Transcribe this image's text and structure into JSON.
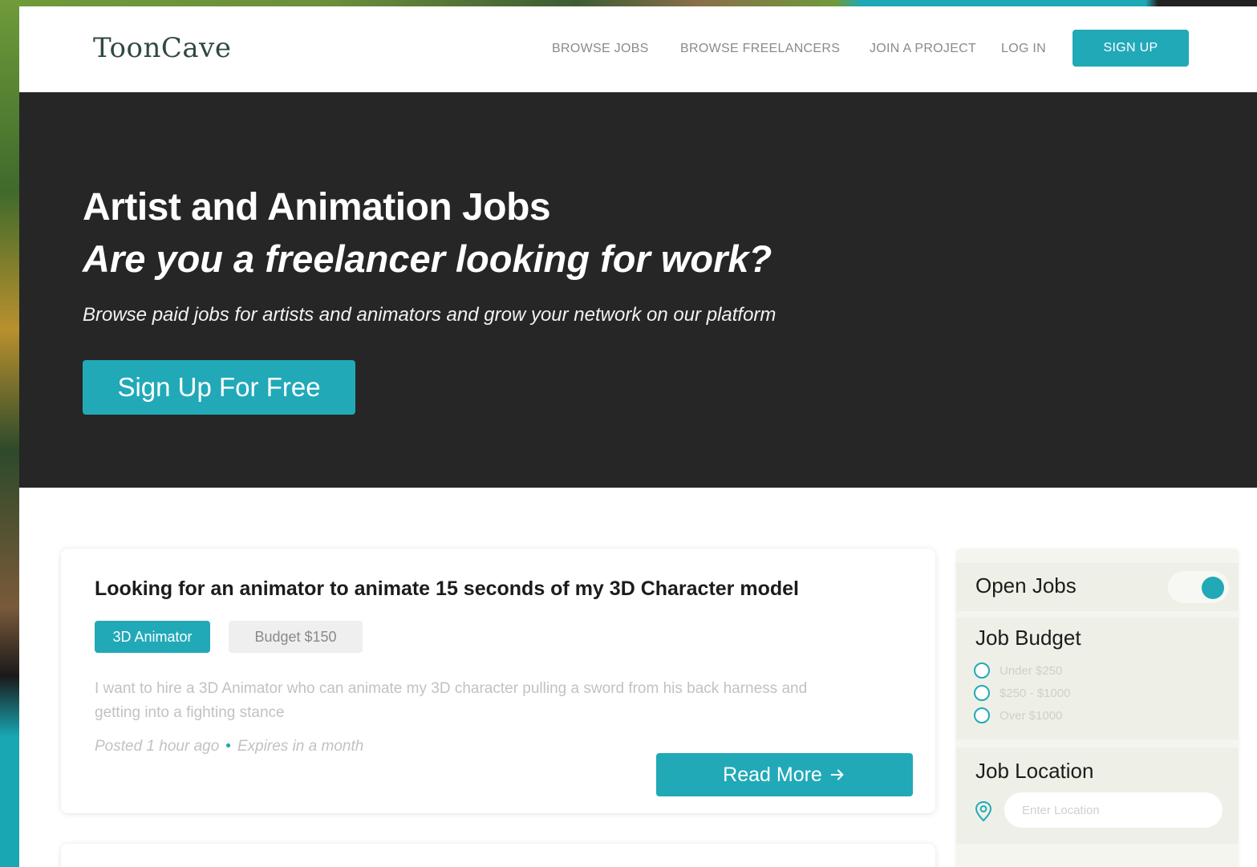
{
  "brand": {
    "name": "ToonCave"
  },
  "nav": {
    "links": [
      "BROWSE JOBS",
      "BROWSE FREELANCERS",
      "JOIN A PROJECT",
      "LOG IN"
    ],
    "signup_label": "SIGN UP"
  },
  "hero": {
    "title": "Artist and Animation Jobs",
    "subtitle": "Are you a freelancer looking for work?",
    "description": "Browse paid jobs for artists and animators and grow your network on our platform",
    "cta_label": "Sign Up For Free"
  },
  "jobs": [
    {
      "title": "Looking for an animator to animate 15 seconds of my 3D Character model",
      "tag_role": "3D Animator",
      "tag_budget": "Budget $150",
      "description": "I want to hire a 3D Animator who can animate my 3D character pulling a sword from his back harness and getting into a fighting stance",
      "posted": "Posted 1 hour ago",
      "separator": "•",
      "expires": "Expires in a month",
      "read_more_label": "Read More"
    }
  ],
  "sidebar": {
    "open_jobs": {
      "label": "Open Jobs",
      "enabled": true
    },
    "budget": {
      "heading": "Job Budget",
      "options": [
        "Under $250",
        "$250 - $1000",
        "Over $1000"
      ]
    },
    "location": {
      "heading": "Job Location",
      "placeholder": "Enter Location",
      "value": ""
    }
  },
  "colors": {
    "accent": "#21a9b8",
    "hero_bg": "#262626",
    "sidebar_bg": "#eef0e7"
  },
  "icons": {
    "read_more": "arrow-right-icon",
    "location": "map-pin-icon"
  }
}
